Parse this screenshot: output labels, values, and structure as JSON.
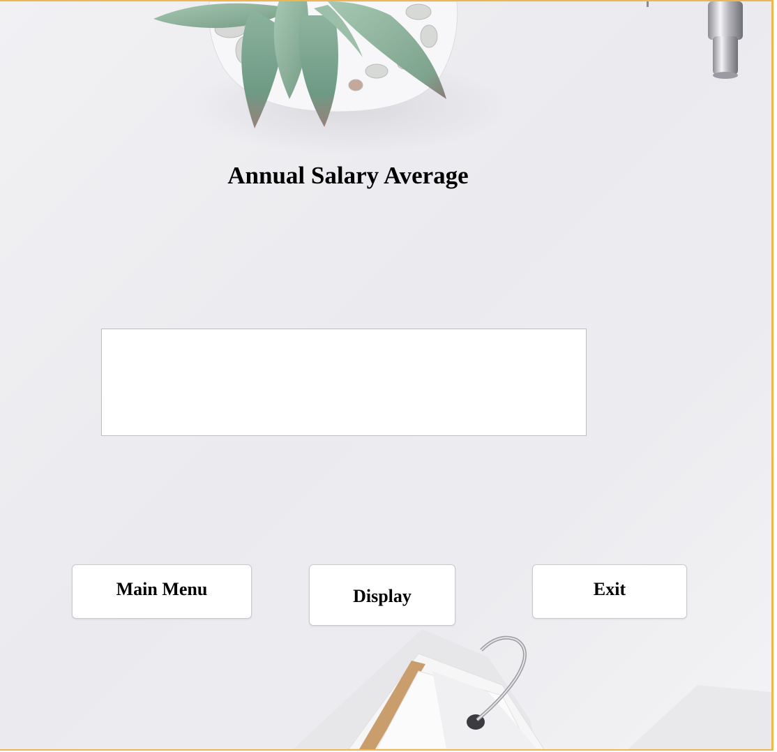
{
  "window": {
    "title": "Annual Salary Average",
    "accent_border_color": "#efb550"
  },
  "output": {
    "value": "",
    "placeholder": ""
  },
  "buttons": {
    "main_menu": "Main Menu",
    "display": "Display",
    "exit": "Exit"
  },
  "background": {
    "decorations": [
      "succulent-plant-pot",
      "pen-cap",
      "ring-bound-cards"
    ]
  }
}
